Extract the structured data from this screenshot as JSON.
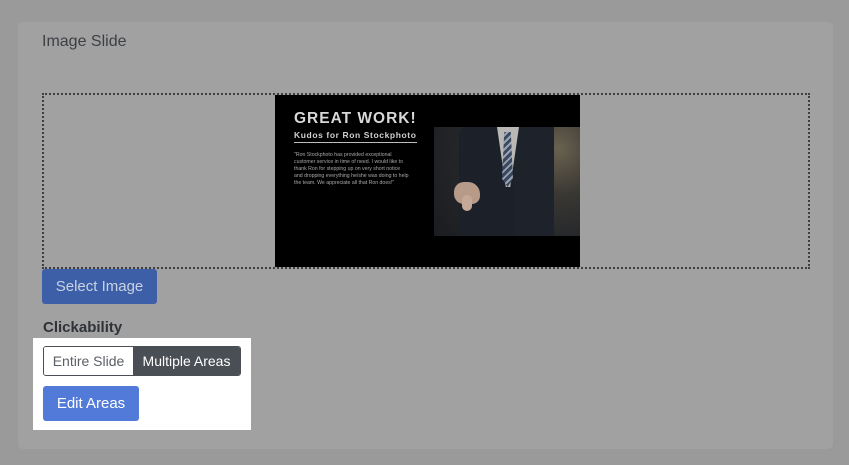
{
  "card": {
    "title": "Image Slide"
  },
  "slide": {
    "title": "GREAT WORK!",
    "subtitle": "Kudos for Ron Stockphoto",
    "quote": "\"Ron Stockphoto has provided exceptional customer service in time of need. I would like to thank Ron for stepping up on very short notice and dropping everything he/she was doing to help the team. We appreciate all that Ron does!\""
  },
  "buttons": {
    "select_image": "Select Image",
    "edit_areas": "Edit Areas"
  },
  "clickability": {
    "label": "Clickability",
    "options": [
      "Entire Slide",
      "Multiple Areas"
    ],
    "selected": "Multiple Areas"
  },
  "colors": {
    "overlay_bg": "#9a9a9b",
    "primary": "#527bd9",
    "toggle_active": "#4a4e55"
  }
}
